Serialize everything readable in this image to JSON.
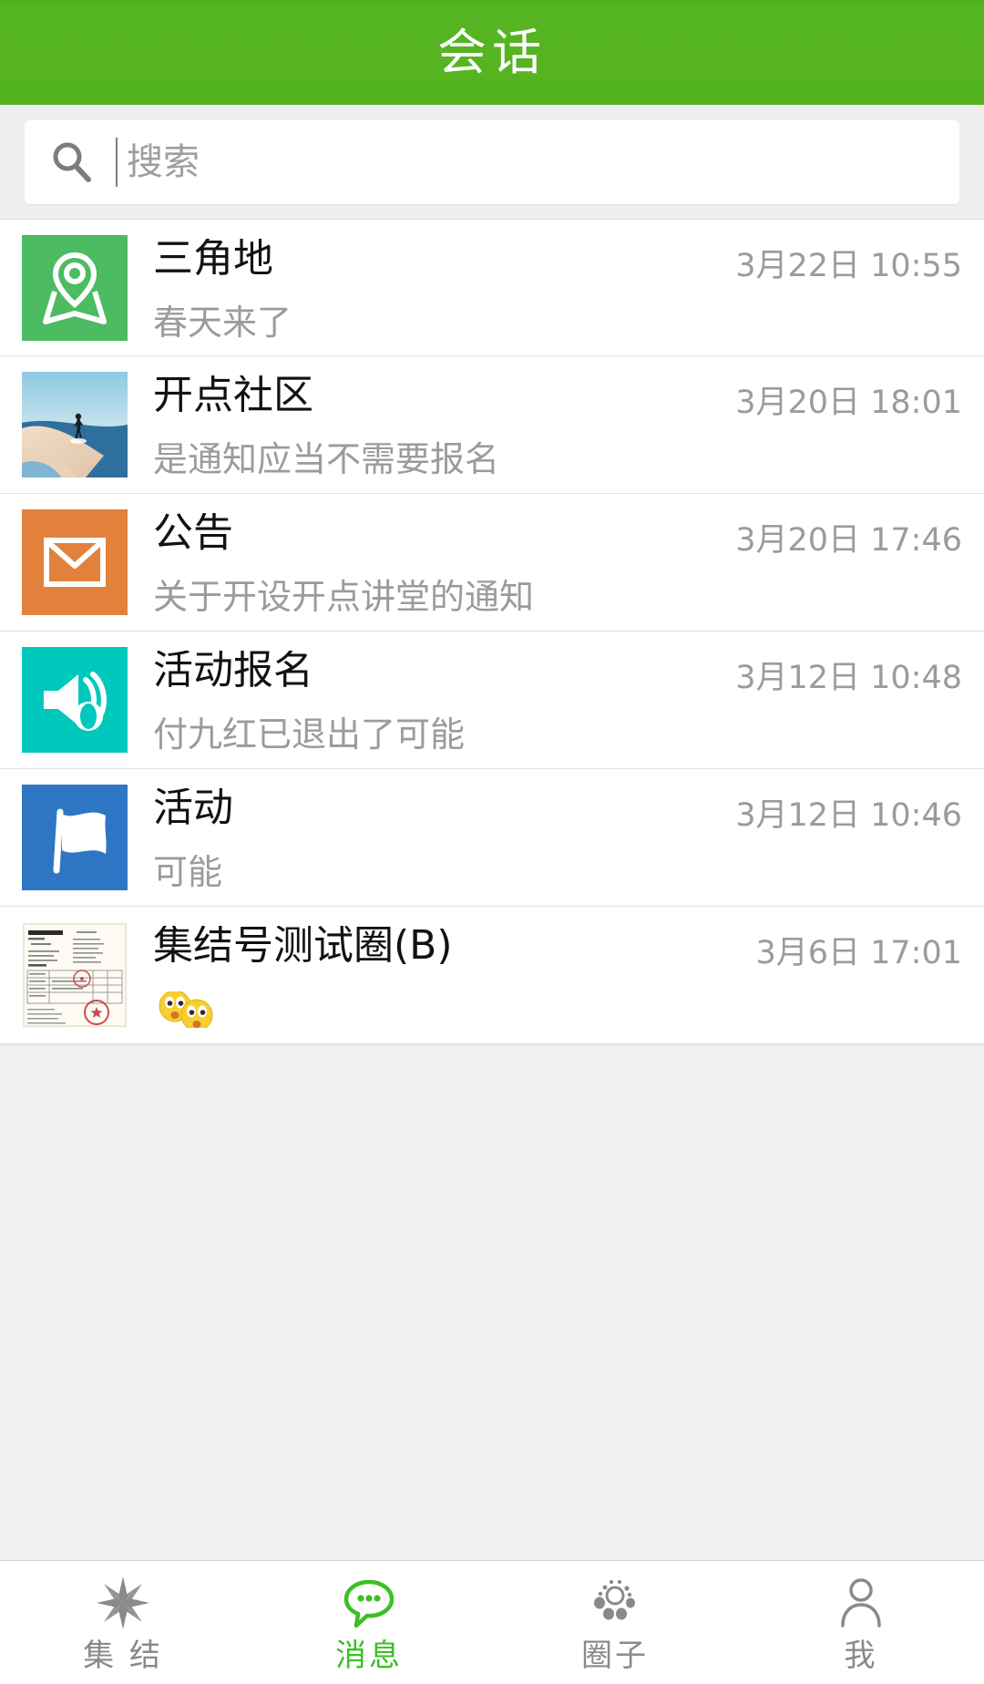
{
  "header": {
    "title": "会话",
    "bg_color": "#54b31f"
  },
  "search": {
    "placeholder": "搜索",
    "value": "",
    "icon": "search-icon"
  },
  "conversations": [
    {
      "title": "三角地",
      "snippet": "春天来了",
      "time": "3月22日 10:55",
      "avatar_kind": "location-pin-icon",
      "avatar_color": "#4cbb62"
    },
    {
      "title": "开点社区",
      "snippet": "是通知应当不需要报名",
      "time": "3月20日 18:01",
      "avatar_kind": "beach-runner-photo",
      "avatar_color": "#9dd0e8"
    },
    {
      "title": "公告",
      "snippet": "关于开设开点讲堂的通知",
      "time": "3月20日 17:46",
      "avatar_kind": "envelope-icon",
      "avatar_color": "#e2813b"
    },
    {
      "title": "活动报名",
      "snippet": "付九红已退出了可能",
      "time": "3月12日 10:48",
      "avatar_kind": "megaphone-icon",
      "avatar_color": "#00c8bd"
    },
    {
      "title": "活动",
      "snippet": "可能",
      "time": "3月12日 10:46",
      "avatar_kind": "flag-icon",
      "avatar_color": "#2e76c4"
    },
    {
      "title": "集结号测试圈(B)",
      "snippet": "",
      "snippet_emoji": "astonished-faces-emoji",
      "time": "3月6日 17:01",
      "avatar_kind": "business-license-photo",
      "avatar_color": "#fdfbf4"
    }
  ],
  "tabbar": {
    "active_color": "#3cbf25",
    "inactive_color": "#8a8a8a",
    "items": [
      {
        "label": "集 结",
        "icon": "compass-star-icon",
        "active": false
      },
      {
        "label": "消息",
        "icon": "chat-bubble-icon",
        "active": true
      },
      {
        "label": "圈子",
        "icon": "circles-cluster-icon",
        "active": false
      },
      {
        "label": "我",
        "icon": "person-icon",
        "active": false
      }
    ]
  }
}
